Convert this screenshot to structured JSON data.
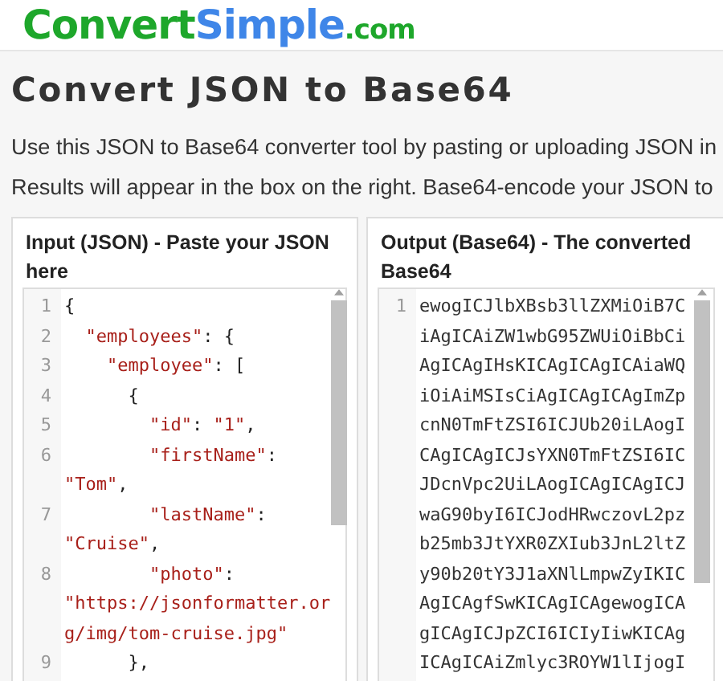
{
  "logo": {
    "part_1": "Convert",
    "part_2": "Simple",
    "part_3": ".com"
  },
  "title": "Convert JSON to Base64",
  "intro": [
    "Use this JSON to Base64 converter tool by pasting or uploading JSON in",
    "Results will appear in the box on the right. Base64-encode your JSON to"
  ],
  "panels": [
    {
      "heading": "Input (JSON) - Paste your JSON here",
      "lines": [
        {
          "number": "1",
          "pieces": [
            "{"
          ]
        },
        {
          "number": "2",
          "pieces": [
            "  \"employees\": {"
          ]
        },
        {
          "number": "3",
          "pieces": [
            "    \"employee\": ["
          ]
        },
        {
          "number": "4",
          "pieces": [
            "      {"
          ]
        },
        {
          "number": "5",
          "pieces": [
            "        \"id\": \"1\","
          ]
        },
        {
          "number": "6",
          "pieces": [
            "        \"firstName\":",
            "\"Tom\","
          ]
        },
        {
          "number": "7",
          "pieces": [
            "        \"lastName\":",
            "\"Cruise\","
          ]
        },
        {
          "number": "8",
          "pieces": [
            "        \"photo\":",
            "\"https://jsonformatter.or",
            "g/img/tom-cruise.jpg\""
          ]
        },
        {
          "number": "9",
          "pieces": [
            "      },"
          ]
        }
      ]
    },
    {
      "heading": "Output (Base64) - The converted Base64",
      "lines": [
        {
          "number": "1",
          "pieces": [
            "ewogICJlbXBsb3llZXMiOiB7C",
            "iAgICAiZW1wbG95ZWUiOiBbCi",
            "AgICAgIHsKICAgICAgICAiaWQ",
            "iOiAiMSIsCiAgICAgICAgImZp",
            "cnN0TmFtZSI6ICJUb20iLAogI",
            "CAgICAgICJsYXN0TmFtZSI6IC",
            "JDcnVpc2UiLAogICAgICAgICJ",
            "waG90byI6ICJodHRwczovL2pz",
            "b25mb3JtYXR0ZXIub3JnL2ltZ",
            "y90b20tY3J1aXNlLmpwZyIKIC",
            "AgICAgfSwKICAgICAgewogICA",
            "gICAgICJpZCI6ICIyIiwKICAg",
            "ICAgICAiZmlyc3ROYW1lIjogI"
          ]
        }
      ]
    }
  ]
}
